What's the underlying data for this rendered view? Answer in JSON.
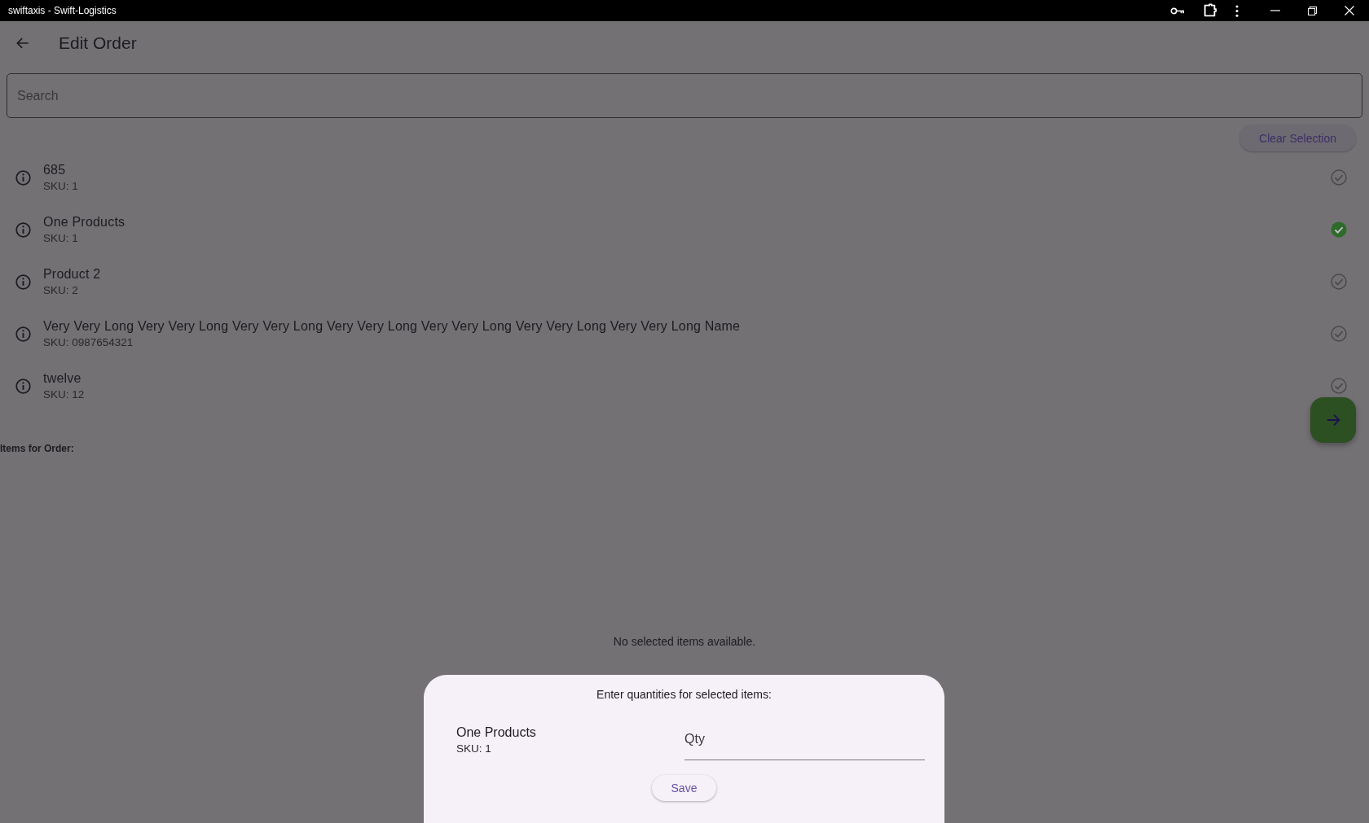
{
  "window": {
    "title": "swiftaxis - Swift-Logistics"
  },
  "app_bar": {
    "title": "Edit Order"
  },
  "search": {
    "placeholder": "Search"
  },
  "clear_button": "Clear Selection",
  "products": [
    {
      "name": "685",
      "sku": "SKU: 1",
      "selected": false
    },
    {
      "name": "One Products",
      "sku": "SKU: 1",
      "selected": true
    },
    {
      "name": "Product 2",
      "sku": "SKU: 2",
      "selected": false
    },
    {
      "name": "Very Very Long Very Very Long Very Very Long Very Very Long Very Very Long Very Very Long Very Very Long Name",
      "sku": "SKU: 0987654321",
      "selected": false
    },
    {
      "name": "twelve",
      "sku": "SKU: 12",
      "selected": false
    }
  ],
  "items_heading": "Items for Order:",
  "empty_message": "No selected items available.",
  "sheet": {
    "prompt": "Enter quantities for selected items:",
    "items": [
      {
        "name": "One Products",
        "sku": "SKU: 1",
        "qty_placeholder": "Qty"
      }
    ],
    "save_button": "Save"
  }
}
